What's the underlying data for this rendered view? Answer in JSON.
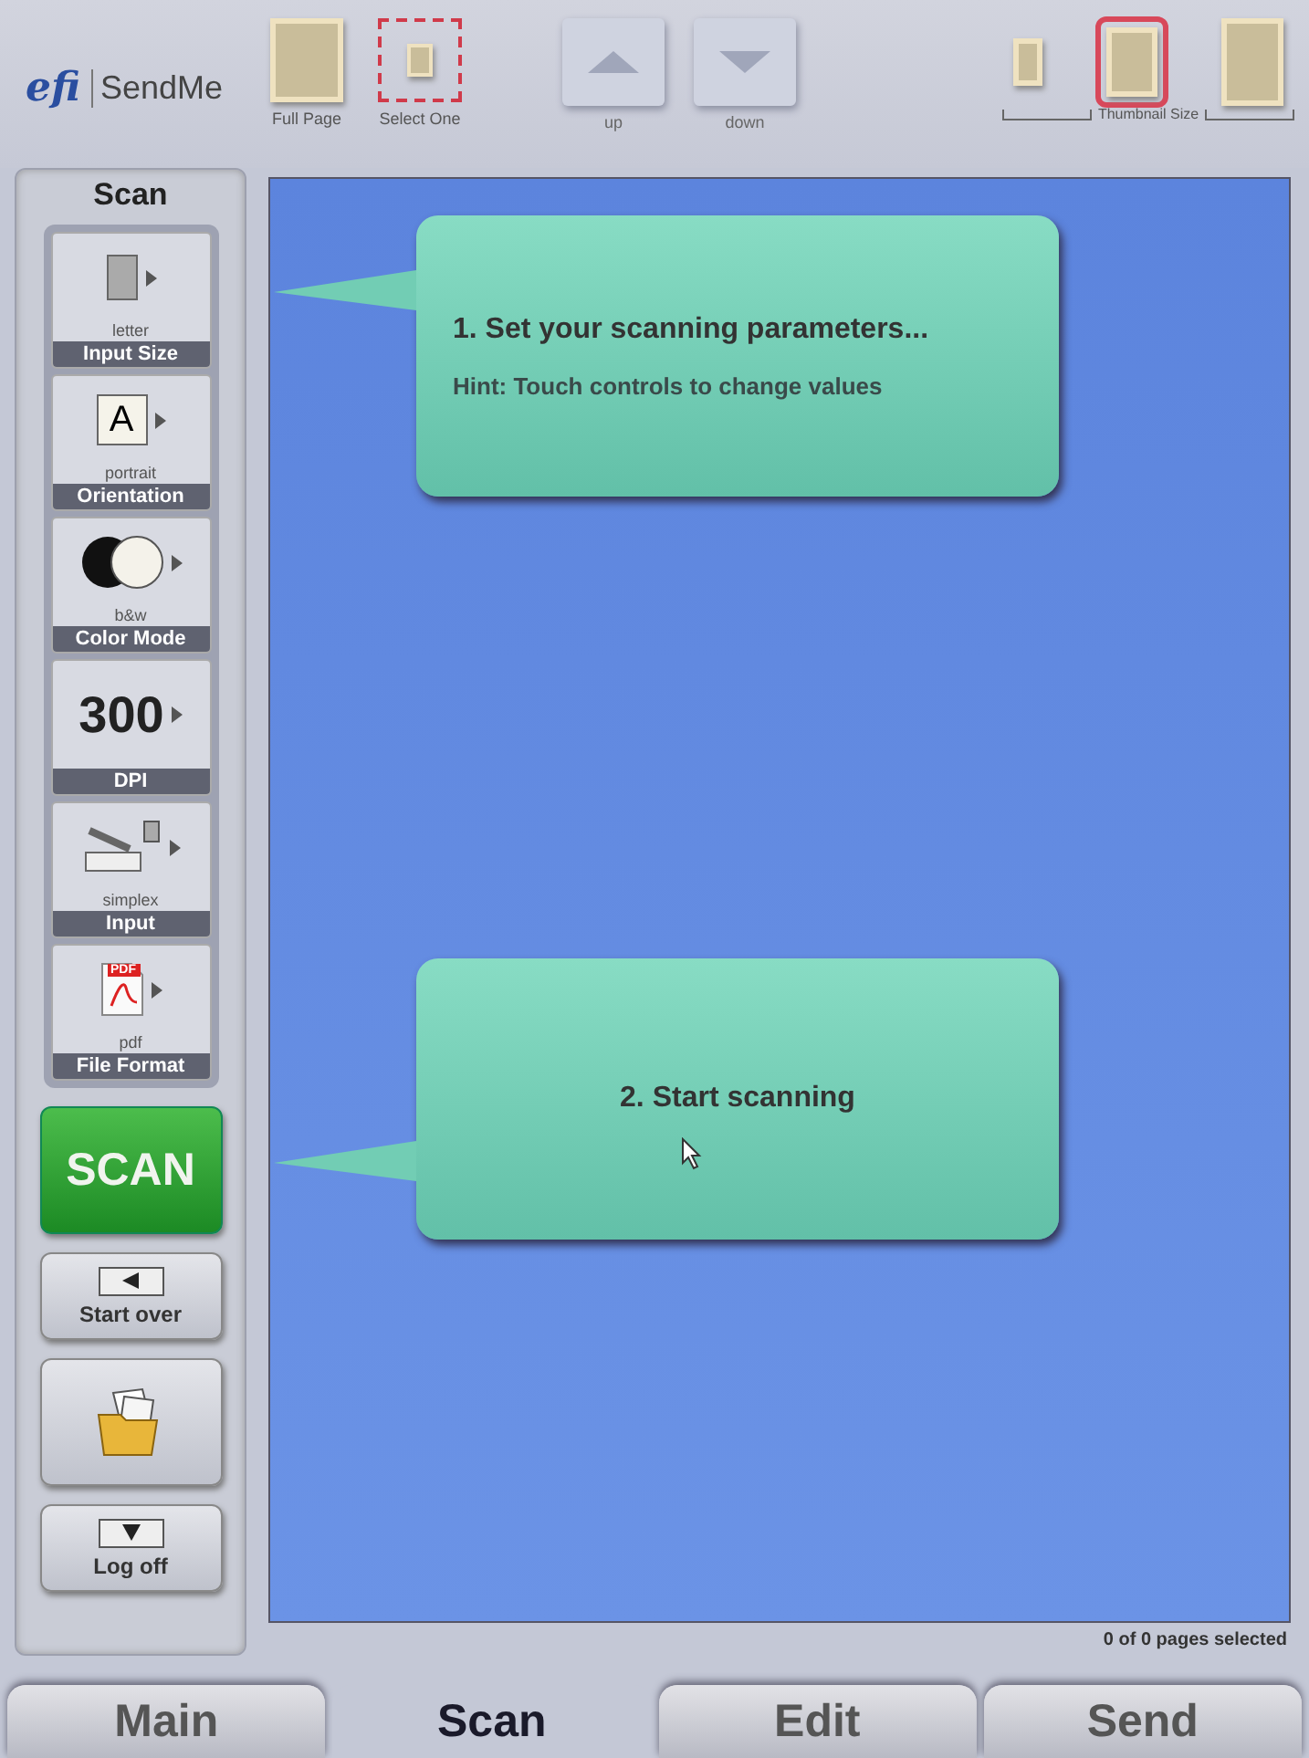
{
  "header": {
    "logo": "efi",
    "app_name": "SendMe"
  },
  "view_buttons": [
    {
      "kind": "full",
      "label": "Full Page"
    },
    {
      "kind": "select",
      "label": "Select One"
    }
  ],
  "nav_buttons": [
    {
      "kind": "up",
      "label": "up"
    },
    {
      "kind": "down",
      "label": "down"
    }
  ],
  "thumbnail_size": {
    "label": "Thumbnail Size",
    "options": [
      {
        "kind": "small",
        "selected": false
      },
      {
        "kind": "medium",
        "selected": true
      },
      {
        "kind": "large",
        "selected": false
      }
    ]
  },
  "sidebar": {
    "title": "Scan",
    "settings": [
      {
        "kind": "page",
        "value": "letter",
        "label": "Input Size"
      },
      {
        "kind": "glyph",
        "glyph": "A",
        "value": "portrait",
        "label": "Orientation"
      },
      {
        "kind": "color",
        "value": "b&w",
        "label": "Color Mode"
      },
      {
        "kind": "number",
        "number": "300",
        "label": "DPI"
      },
      {
        "kind": "scanner",
        "value": "simplex",
        "label": "Input"
      },
      {
        "kind": "pdf",
        "badge": "PDF",
        "value": "pdf",
        "label": "File Format"
      }
    ]
  },
  "actions": [
    {
      "kind": "scan",
      "label": "SCAN"
    },
    {
      "kind": "back",
      "label": "Start over"
    },
    {
      "kind": "folder"
    },
    {
      "kind": "logoff",
      "label": "Log off"
    }
  ],
  "callouts": [
    {
      "title": "1. Set your scanning parameters...",
      "hint": "Hint: Touch controls to change values",
      "cursor": false
    },
    {
      "title": "2. Start scanning",
      "cursor": true
    }
  ],
  "status": "0 of 0 pages selected",
  "tabs": [
    {
      "label": "Main",
      "selected": false
    },
    {
      "label": "Scan",
      "selected": true
    },
    {
      "label": "Edit",
      "selected": false
    },
    {
      "label": "Send",
      "selected": false
    }
  ]
}
